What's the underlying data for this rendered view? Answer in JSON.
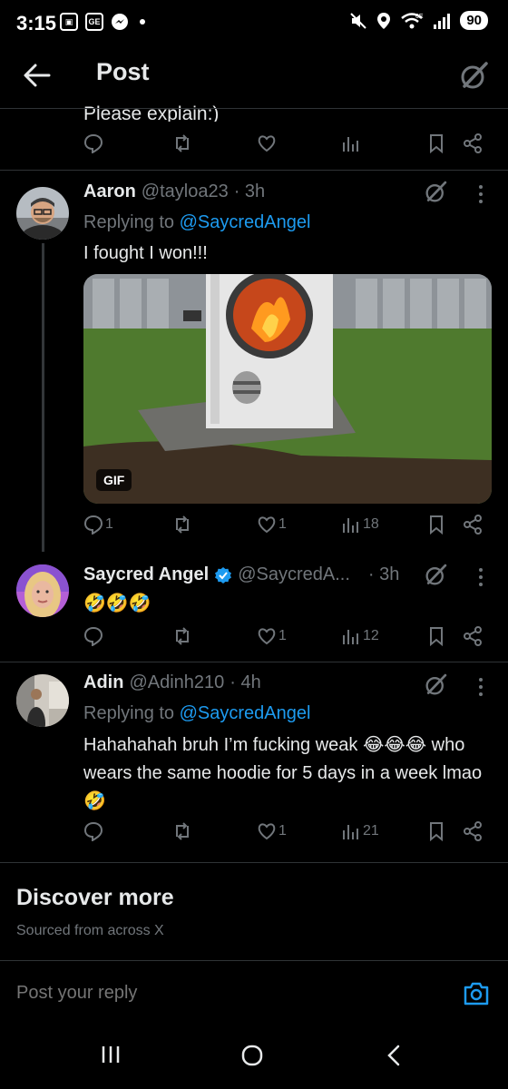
{
  "status_bar": {
    "time": "3:15",
    "badge": "GE",
    "battery": "90",
    "network": "6E"
  },
  "header": {
    "title": "Post"
  },
  "partial_post": {
    "text": "Please explain:)"
  },
  "replies": [
    {
      "name": "Aaron",
      "handle": "@tayloa23",
      "time": "· 3h",
      "replying_label": "Replying to",
      "replying_to": "@SaycredAngel",
      "text": "I fought I won!!!",
      "gif_label": "GIF",
      "replies": "1",
      "reposts": "",
      "likes": "1",
      "views": "18"
    },
    {
      "name": "Saycred Angel",
      "handle": "@SaycredA...",
      "time": "· 3h",
      "verified": true,
      "text": "🤣🤣🤣",
      "replies": "",
      "reposts": "",
      "likes": "1",
      "views": "12"
    },
    {
      "name": "Adin",
      "handle": "@Adinh210",
      "time": "· 4h",
      "replying_label": "Replying to",
      "replying_to": "@SaycredAngel",
      "text": "Hahahahah bruh I’m fucking weak 😂😂😂 who wears the same hoodie for 5 days in a week lmao 🤣",
      "replies": "",
      "reposts": "",
      "likes": "1",
      "views": "21"
    }
  ],
  "discover": {
    "title": "Discover more",
    "subtitle": "Sourced from across X"
  },
  "reply_box": {
    "placeholder": "Post your reply"
  },
  "colors": {
    "background": "#000000",
    "text": "#e7e9ea",
    "muted": "#71767b",
    "accent": "#1d9bf0",
    "divider": "#2f3336"
  }
}
